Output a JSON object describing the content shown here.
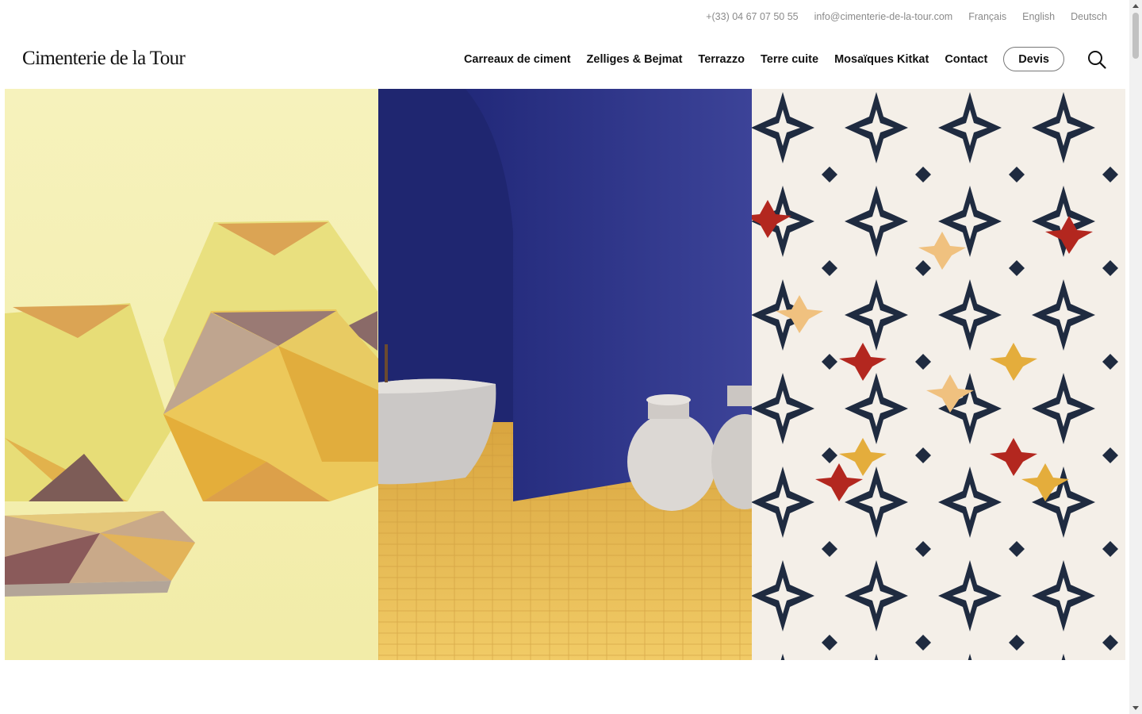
{
  "utility": {
    "phone": "+(33) 04 67 07 50 55",
    "email": "info@cimenterie-de-la-tour.com",
    "languages": [
      "Français",
      "English",
      "Deutsch"
    ]
  },
  "header": {
    "logo": "Cimenterie de la Tour",
    "nav": [
      "Carreaux de ciment",
      "Zelliges & Bejmat",
      "Terrazzo",
      "Terre cuite",
      "Mosaïques Kitkat",
      "Contact"
    ],
    "cta": "Devis",
    "search_icon": "search-icon"
  },
  "hero": {
    "panels": [
      {
        "name": "hexagon-cement-tiles",
        "colors": {
          "bg": "#f5f0b3",
          "yellow": "#e8c84a",
          "ochre": "#dba454",
          "plum": "#8a6a68"
        }
      },
      {
        "name": "zellige-bathroom",
        "colors": {
          "wall": "#2c3489",
          "floor": "#e3b84d",
          "tub": "#c9c6c4"
        }
      },
      {
        "name": "star-pattern-floor",
        "colors": {
          "bg": "#f3efe9",
          "navy": "#1e2a3e",
          "red": "#b3271f",
          "gold": "#e4ad3c",
          "peach": "#f0c17f"
        }
      }
    ]
  }
}
